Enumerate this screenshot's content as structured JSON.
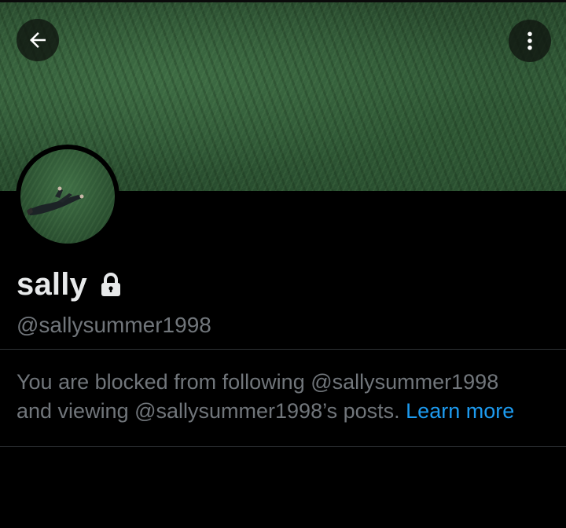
{
  "header": {
    "back_icon": "arrow-left-icon",
    "more_icon": "more-vertical-icon"
  },
  "profile": {
    "display_name": "sally",
    "protected_icon": "lock-icon",
    "handle": "@sallysummer1998"
  },
  "blocked_notice": {
    "line1": "You are blocked from following @sallysummer1998",
    "line2": "and viewing @sallysummer1998’s posts.",
    "learn_more": "Learn more"
  },
  "colors": {
    "background": "#000000",
    "primary_text": "#e7e9ea",
    "secondary_text": "#71767b",
    "link": "#1d9bf0",
    "divider": "#2f3336"
  }
}
